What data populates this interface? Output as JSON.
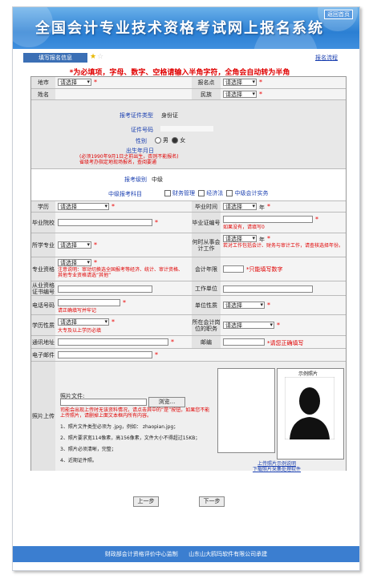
{
  "app": {
    "title": "全国会计专业技术资格考试网上报名系统",
    "home_label": "返回首页"
  },
  "tabbar": {
    "tab_label": "填写报名信息",
    "process_link": "报名流程"
  },
  "notice": "*为必填项，字母、数字、空格请输入半角字符，全角会自动转为半角",
  "form": {
    "region_label": "地市",
    "region_value": "请选择",
    "site_label": "报名点",
    "site_value": "请选择",
    "name_label": "姓名",
    "name_value": "",
    "ethnic_label": "民族",
    "ethnic_value": "请选择",
    "id_type_label": "报考证件类型",
    "id_type_value": "身份证",
    "id_no_label": "证件号码",
    "id_no_value": "",
    "gender_label": "性别",
    "gender_male": "男",
    "gender_female": "女",
    "birth_label": "出生年月日",
    "birth_value": "",
    "birth_note_1": "(必须1990年9月1日之前出生，否则不能报名)",
    "birth_note_2": "省级考办指定地现场报名，查阅要通",
    "level_label": "报考级别",
    "level_value": "中级",
    "subject_label": "中级报考科目",
    "subject_1": "财务管理",
    "subject_2": "经济法",
    "subject_3": "中级会计实务",
    "education_label": "学历",
    "education_value": "请选择",
    "grad_time_label": "毕业时间",
    "grad_time_value": "请选择",
    "grad_time_unit": "年",
    "school_label": "毕业院校",
    "school_value": "",
    "cert_no_label": "毕业证编号",
    "cert_no_value": "",
    "cert_no_note": "如果没有，请填写0",
    "major_label": "所学专业",
    "major_value": "请选择",
    "work_time_label": "何时从事会计工作",
    "work_time_value": "请选择",
    "work_time_unit": "年",
    "work_time_note": "若对工作包括会计、财务与审计工作，请查核选择年份。",
    "qual_label": "专业资格",
    "qual_value": "请选择",
    "qual_note": "注意说明：审动切换选全国报考等经济、统计、审计资格、其他专业资格请选“其他”",
    "years_label": "会计年限",
    "years_value": "",
    "years_note": "*只能填写数字",
    "qual_cert_label": "从业资格证书编号",
    "qual_cert_value": "",
    "employer_label": "工作单位",
    "employer_value": "",
    "phone_label": "电话号码",
    "phone_value": "",
    "phone_note": "请正确填写并牢记",
    "unit_type_label": "单位性质",
    "unit_type_value": "请选择",
    "degree_type_label": "学历性质",
    "degree_type_value": "请选择",
    "degree_type_note": "大专及以上学历必填",
    "post_label": "所在会计岗位的职务",
    "post_value": "请选择",
    "address_label": "通讯地址",
    "address_value": "",
    "zip_label": "邮编",
    "zip_value": "",
    "zip_note": "*请您正确填写",
    "email_label": "电子邮件",
    "email_value": "",
    "photo_label": "照片上传",
    "photo_file_label": "照片文件:",
    "browse_label": "浏览...",
    "photo_warn": "司能会出现上传时无该资料情况，请点击其中的“是”按钮，如果您不能上传照片，请删掉上面文本框内所有内容。",
    "photo_rule_1": "1、照片文件类型必须为 .jpg，例如：   zhaopian.jpg；",
    "photo_rule_2": "2、照片要求宽114像素，高156像素，文件大小不得超过15KB；",
    "photo_rule_3": "3、照片必须清晰，完整；",
    "photo_rule_4": "4、近期证件照。",
    "sample_label": "示例照片",
    "photo_link_1": "上传照片示例说明",
    "photo_link_2": "下载照片采集处理软件"
  },
  "buttons": {
    "prev": "上一步",
    "next": "下一步"
  },
  "footer": {
    "org": "财政部会计资格评价中心监制",
    "dev": "山东山大鸥玛软件有限公司承建"
  }
}
